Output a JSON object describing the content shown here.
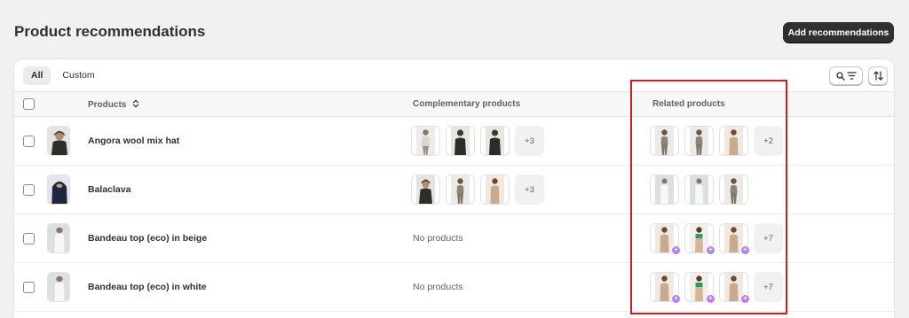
{
  "header": {
    "title": "Product recommendations",
    "add_button_label": "Add recommendations"
  },
  "tabs": [
    {
      "label": "All",
      "active": true
    },
    {
      "label": "Custom",
      "active": false
    }
  ],
  "toolbar": {
    "search_filter_icon": "search-filter-icon",
    "sort_icon": "sort-icon"
  },
  "table": {
    "columns": {
      "products": "Products",
      "complementary": "Complementary products",
      "related": "Related products"
    },
    "rows": [
      {
        "name": "Angora wool mix hat",
        "complementary": {
          "more": "+3",
          "empty_text": ""
        },
        "related": {
          "more": "+2"
        }
      },
      {
        "name": "Balaclava",
        "complementary": {
          "more": "+3",
          "empty_text": ""
        },
        "related": {
          "more": ""
        }
      },
      {
        "name": "Bandeau top (eco) in beige",
        "complementary": {
          "more": "",
          "empty_text": "No products"
        },
        "related": {
          "more": "+7"
        }
      },
      {
        "name": "Bandeau top (eco) in white",
        "complementary": {
          "more": "",
          "empty_text": "No products"
        },
        "related": {
          "more": "+7"
        }
      }
    ]
  },
  "colors": {
    "accent_dark": "#303030",
    "highlight_red": "#cc1f1f",
    "ai_badge": "#b57ef2"
  }
}
